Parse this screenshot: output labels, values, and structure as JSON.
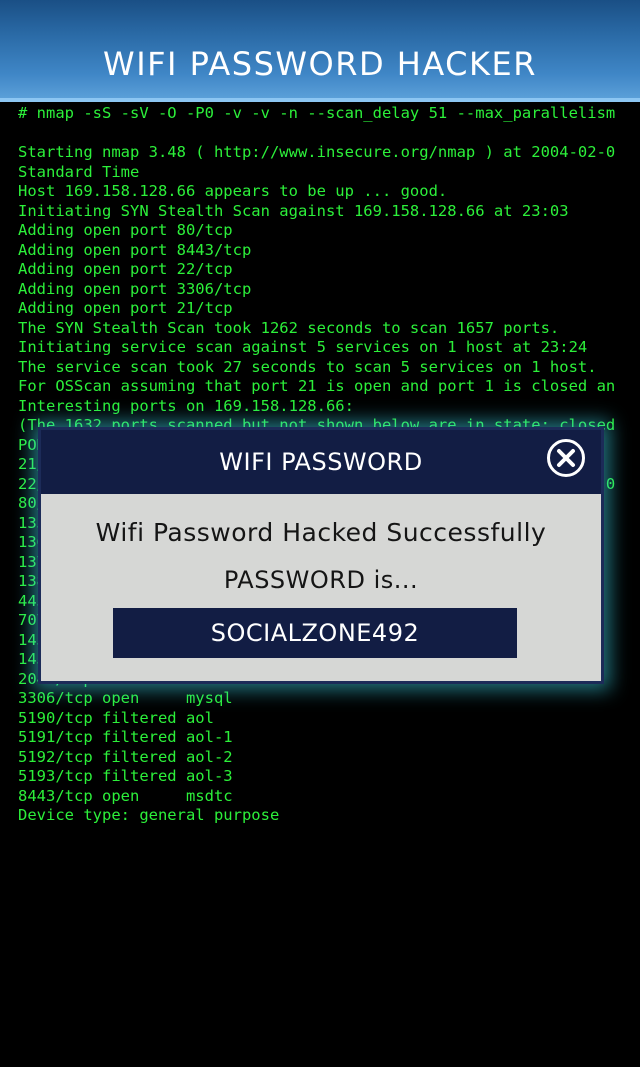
{
  "app": {
    "title": "WIFI PASSWORD HACKER"
  },
  "terminal": {
    "lines": [
      "# nmap -sS -sV -O -P0 -v -v -n --scan_delay 51 --max_parallelism",
      "",
      "Starting nmap 3.48 ( http://www.insecure.org/nmap ) at 2004-02-0",
      "Standard Time",
      "Host 169.158.128.66 appears to be up ... good.",
      "Initiating SYN Stealth Scan against 169.158.128.66 at 23:03",
      "Adding open port 80/tcp",
      "Adding open port 8443/tcp",
      "Adding open port 22/tcp",
      "Adding open port 3306/tcp",
      "Adding open port 21/tcp",
      "The SYN Stealth Scan took 1262 seconds to scan 1657 ports.",
      "Initiating service scan against 5 services on 1 host at 23:24",
      "The service scan took 27 seconds to scan 5 services on 1 host.",
      "For OSScan assuming that port 21 is open and port 1 is closed an",
      "Interesting ports on 169.158.128.66:",
      "(The 1632 ports scanned but not shown below are in state: closed",
      "PORT     STATE    SERVICE",
      "21/tcp   open     ftp",
      "22/tcp   open     ssh                                       .1.0",
      "80/tcp   open     http",
      "135/tcp  filtered msrpc",
      "136/tcp  filtered profile",
      "137/tcp  filtered netbios-ns",
      "138/tcp  filtered netbios-dgm",
      "445/tcp  filtered microsoft-ds",
      "707/tcp  filtered unknown",
      "1433/tcp filtered ms-sql-s",
      "1434/tcp filtered ms-sql-m",
      "2049/tcp filtered nfs",
      "3306/tcp open     mysql",
      "5190/tcp filtered aol",
      "5191/tcp filtered aol-1",
      "5192/tcp filtered aol-2",
      "5193/tcp filtered aol-3",
      "8443/tcp open     msdtc",
      "Device type: general purpose"
    ]
  },
  "dialog": {
    "title": "WIFI PASSWORD",
    "message": "Wifi Password Hacked Successfully",
    "subtitle": "PASSWORD is...",
    "password": "SOCIALZONE492",
    "close_icon": "close-circle-icon"
  },
  "colors": {
    "terminal_text": "#2cf03a",
    "header_blue": "#2a6aa6",
    "dialog_navy": "#121d44",
    "dialog_body": "#d6d7d5"
  }
}
